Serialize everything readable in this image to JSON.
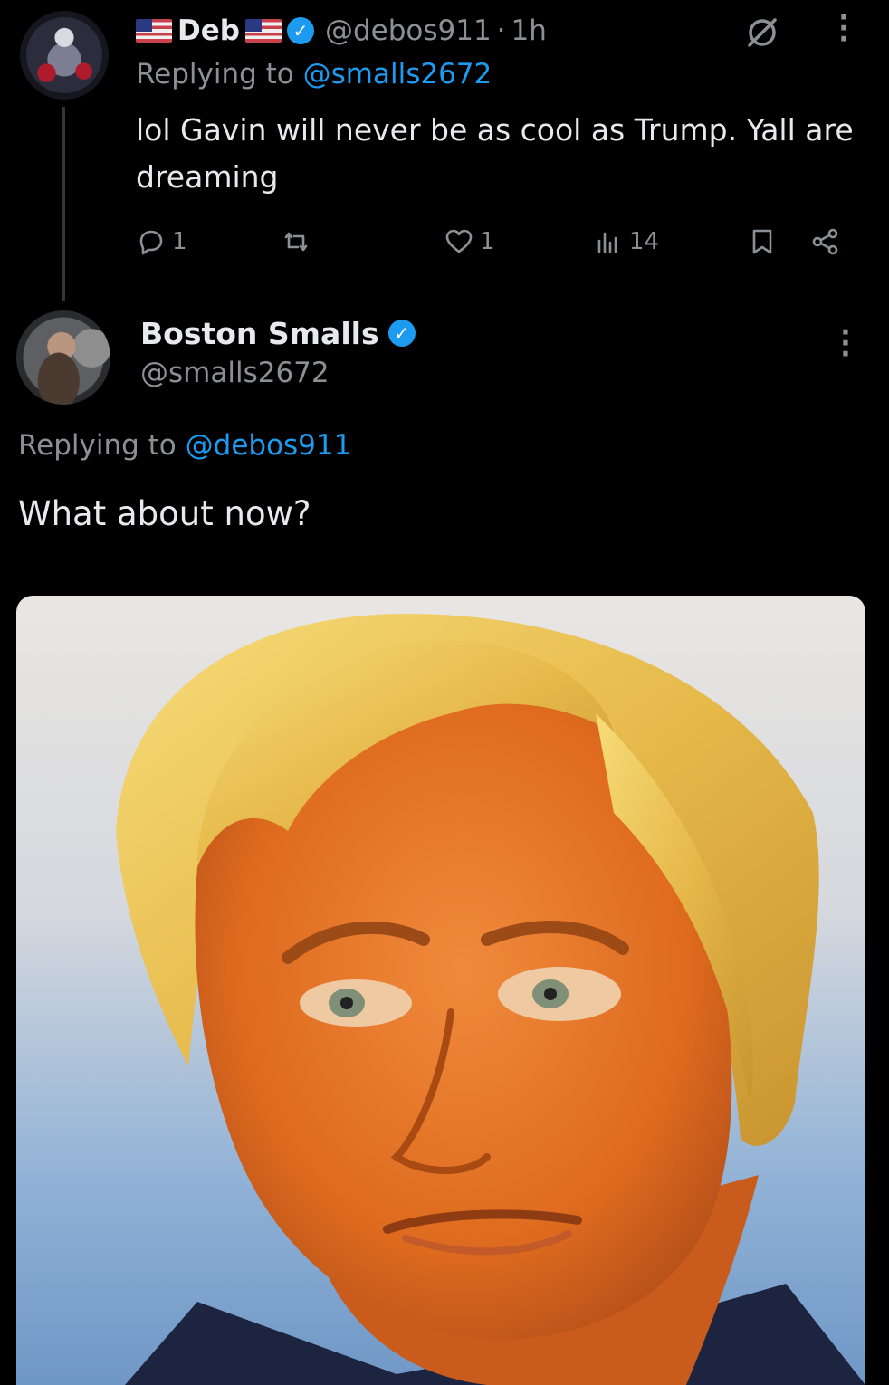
{
  "tweet1": {
    "display_name": "Deb",
    "handle": "@debos911",
    "separator": "·",
    "time": "1h",
    "replying_prefix": "Replying to",
    "replying_to": "@smalls2672",
    "text": "lol Gavin will never be as cool as Trump. Yall are dreaming",
    "stats": {
      "replies": "1",
      "reposts": "",
      "likes": "1",
      "views": "14"
    }
  },
  "tweet2": {
    "display_name": "Boston Smalls",
    "handle": "@smalls2672",
    "replying_prefix": "Replying to",
    "replying_to": "@debos911",
    "text": "What about now?"
  },
  "icons": {
    "flag": "us-flag-icon",
    "verified": "verified-badge-icon",
    "grok": "grok-icon",
    "more": "more-options-icon",
    "reply": "reply-icon",
    "repost": "repost-icon",
    "like": "like-icon",
    "views": "views-icon",
    "bookmark": "bookmark-icon",
    "share": "share-icon"
  },
  "colors": {
    "background": "#000000",
    "text": "#e7e9ea",
    "muted": "#8b9096",
    "accent": "#1d9bf0"
  }
}
